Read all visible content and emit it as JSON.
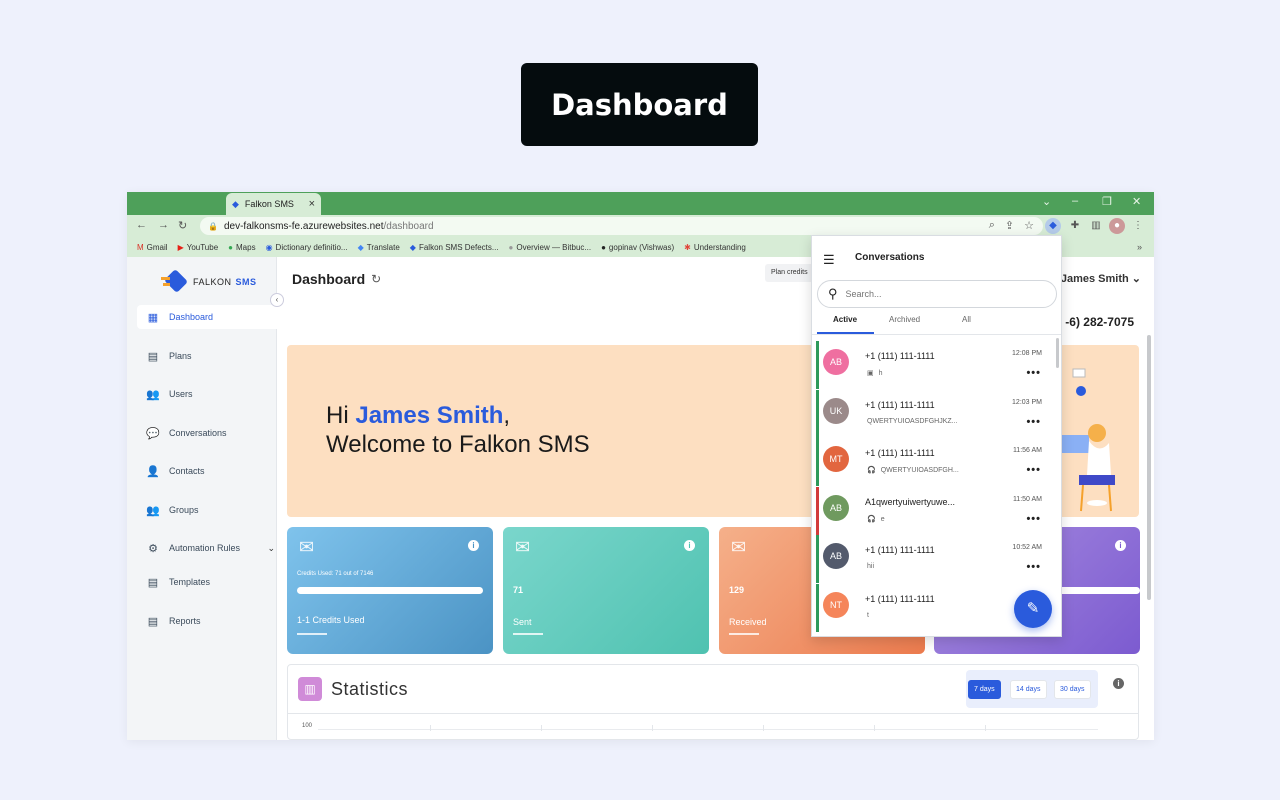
{
  "badge": "Dashboard",
  "browser": {
    "tab_title": "Falkon SMS",
    "tab_close": "×",
    "url_host": "dev-falkonsms-fe.azurewebsites.net",
    "url_path": "/dashboard",
    "bookmarks": [
      {
        "label": "Gmail",
        "icon": "M",
        "color": "#d93025"
      },
      {
        "label": "YouTube",
        "icon": "▶",
        "color": "#e62117"
      },
      {
        "label": "Maps",
        "icon": "●",
        "color": "#34a853"
      },
      {
        "label": "Dictionary definitio...",
        "icon": "◉",
        "color": "#2a5bdc"
      },
      {
        "label": "Translate",
        "icon": "◆",
        "color": "#4285f4"
      },
      {
        "label": "Falkon SMS Defects...",
        "icon": "◆",
        "color": "#2a5bdc"
      },
      {
        "label": "Overview — Bitbuc...",
        "icon": "●",
        "color": "#999"
      },
      {
        "label": "gopinav (Vishwas)",
        "icon": "●",
        "color": "#222"
      },
      {
        "label": "Understanding",
        "icon": "✱",
        "color": "#e0453a"
      }
    ],
    "bookmarks_more": "»"
  },
  "app": {
    "logo_text": "FALKON",
    "logo_sms": "SMS",
    "nav": [
      {
        "label": "Dashboard",
        "icon": "grid-icon",
        "glyph": "▦",
        "active": true
      },
      {
        "label": "Plans",
        "icon": "document-icon",
        "glyph": "▤"
      },
      {
        "label": "Users",
        "icon": "users-icon",
        "glyph": "👥"
      },
      {
        "label": "Conversations",
        "icon": "chat-icon",
        "glyph": "💬"
      },
      {
        "label": "Contacts",
        "icon": "person-icon",
        "glyph": "👤"
      },
      {
        "label": "Groups",
        "icon": "group-icon",
        "glyph": "👥"
      },
      {
        "label": "Automation Rules",
        "icon": "gear-icon",
        "glyph": "⚙",
        "chevron": "⌄"
      },
      {
        "label": "Templates",
        "icon": "template-icon",
        "glyph": "▤"
      },
      {
        "label": "Reports",
        "icon": "report-icon",
        "glyph": "▤"
      }
    ],
    "page_title": "Dashboard",
    "plan_credits": "Plan credits",
    "user_name": "James Smith",
    "phone": "-6) 282-7075",
    "hero": {
      "hi": "Hi",
      "name": "James Smith",
      "comma": ",",
      "welcome": "Welcome to Falkon SMS"
    },
    "cards": [
      {
        "small": "Credits Used:  71 out of 7146",
        "subtitle": "1-1 Credits Used",
        "progress": 0.0099
      },
      {
        "value": "71",
        "subtitle": "Sent"
      },
      {
        "value": "129",
        "subtitle": "Received"
      },
      {
        "progress": 1.0
      }
    ],
    "stats": {
      "title": "Statistics",
      "ranges": [
        "7 days",
        "14 days",
        "30 days"
      ],
      "selected_range": "7 days",
      "ytick": "100"
    }
  },
  "conversations": {
    "title": "Conversations",
    "search_placeholder": "Search...",
    "tabs": [
      "Active",
      "Archived",
      "All"
    ],
    "active_tab": "Active",
    "items": [
      {
        "initials": "AB",
        "name": "+1 (111) 111-1111",
        "preview": "h",
        "preview_icon": "image-icon",
        "time": "12:08 PM",
        "avatar_color": "#ef6fa0",
        "stripe": "#2e9a5b"
      },
      {
        "initials": "UK",
        "name": "+1 (111) 111-1111",
        "preview": "QWERTYUIOASDFGHJKZ...",
        "preview_icon": "",
        "time": "12:03 PM",
        "avatar_color": "#9b8a8a",
        "stripe": "#2e9a5b"
      },
      {
        "initials": "MT",
        "name": "+1 (111) 111-1111",
        "preview": "QWERTYUIOASDFGH...",
        "preview_icon": "headset-icon",
        "time": "11:56 AM",
        "avatar_color": "#e2663f",
        "stripe": "#2e9a5b"
      },
      {
        "initials": "AB",
        "name": "A1qwertyuiwertyuwe...",
        "preview": "e",
        "preview_icon": "headset-icon",
        "time": "11:50 AM",
        "avatar_color": "#6f9a5f",
        "stripe": "#d23b3b"
      },
      {
        "initials": "AB",
        "name": "+1 (111) 111-1111",
        "preview": "hii",
        "preview_icon": "",
        "time": "10:52 AM",
        "avatar_color": "#535a6c",
        "stripe": "#2e9a5b"
      },
      {
        "initials": "NT",
        "name": "+1 (111) 111-1111",
        "preview": "t",
        "preview_icon": "",
        "time": "10:",
        "avatar_color": "#f5855a",
        "stripe": "#2e9a5b"
      }
    ],
    "more": "•••"
  }
}
